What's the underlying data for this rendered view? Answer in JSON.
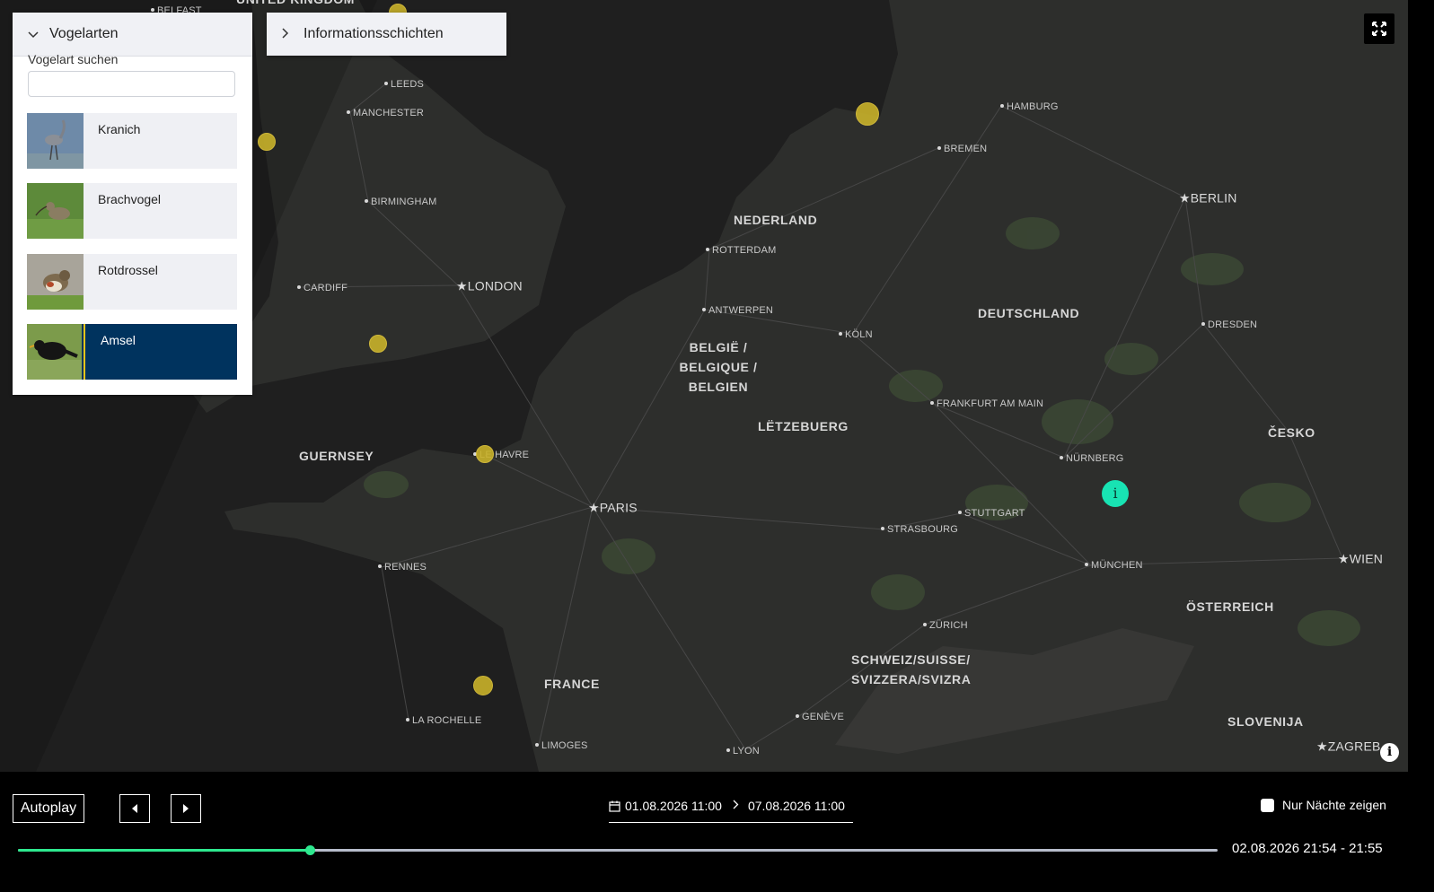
{
  "map": {
    "countries": [
      {
        "id": "united-kingdom",
        "label": "UNITED KINGDOM"
      },
      {
        "id": "nederland",
        "label": "NEDERLAND"
      },
      {
        "id": "deutschland",
        "label": "DEUTSCHLAND"
      },
      {
        "id": "belgie",
        "label": "BELGIË / BELGIQUE / BELGIEN"
      },
      {
        "id": "letzebuerg",
        "label": "LËTZEBUERG"
      },
      {
        "id": "guernsey",
        "label": "GUERNSEY"
      },
      {
        "id": "france",
        "label": "FRANCE"
      },
      {
        "id": "cesko",
        "label": "ČESKO"
      },
      {
        "id": "osterreich",
        "label": "ÖSTERREICH"
      },
      {
        "id": "schweiz",
        "label": "SCHWEIZ/SUISSE/ SVIZZERA/SVIZRA"
      },
      {
        "id": "slovenija",
        "label": "SLOVENIJA"
      }
    ],
    "cities": [
      {
        "id": "belfast",
        "label": "BELFAST"
      },
      {
        "id": "leeds",
        "label": "LEEDS"
      },
      {
        "id": "manchester",
        "label": "MANCHESTER"
      },
      {
        "id": "birmingham",
        "label": "BIRMINGHAM"
      },
      {
        "id": "cardiff",
        "label": "CARDIFF"
      },
      {
        "id": "hamburg",
        "label": "HAMBURG"
      },
      {
        "id": "bremen",
        "label": "BREMEN"
      },
      {
        "id": "rotterdam",
        "label": "ROTTERDAM"
      },
      {
        "id": "antwerpen",
        "label": "ANTWERPEN"
      },
      {
        "id": "koln",
        "label": "KÖLN"
      },
      {
        "id": "dresden",
        "label": "DRESDEN"
      },
      {
        "id": "frankfurt",
        "label": "FRANKFURT AM MAIN"
      },
      {
        "id": "nurnberg",
        "label": "NÜRNBERG"
      },
      {
        "id": "stuttgart",
        "label": "STUTTGART"
      },
      {
        "id": "strasbourg",
        "label": "STRASBOURG"
      },
      {
        "id": "munchen",
        "label": "MÜNCHEN"
      },
      {
        "id": "le-havre",
        "label": "LE HAVRE"
      },
      {
        "id": "rennes",
        "label": "RENNES"
      },
      {
        "id": "zurich",
        "label": "ZÜRICH"
      },
      {
        "id": "geneve",
        "label": "GENÈVE"
      },
      {
        "id": "lyon",
        "label": "LYON"
      },
      {
        "id": "la-rochelle",
        "label": "LA ROCHELLE"
      },
      {
        "id": "limoges",
        "label": "LIMOGES"
      }
    ],
    "capitals": [
      {
        "id": "london",
        "label": "LONDON"
      },
      {
        "id": "berlin",
        "label": "BERLIN"
      },
      {
        "id": "paris",
        "label": "PARIS"
      },
      {
        "id": "wien",
        "label": "WIEN"
      },
      {
        "id": "zagreb",
        "label": "ZAGREB"
      }
    ],
    "info_marker_symbol": "i",
    "colors": {
      "land": "#2b2b2b",
      "water": "#1f1f1f",
      "marker": "#c9b22a",
      "info": "#18e3b3"
    }
  },
  "bird_panel": {
    "title": "Vogelarten",
    "search_label": "Vogelart suchen",
    "search_value": "",
    "search_placeholder": "",
    "birds": [
      {
        "name": "Kranich",
        "selected": false
      },
      {
        "name": "Brachvogel",
        "selected": false
      },
      {
        "name": "Rotdrossel",
        "selected": false
      },
      {
        "name": "Amsel",
        "selected": true
      }
    ]
  },
  "info_panel": {
    "title": "Informationsschichten"
  },
  "controls": {
    "autoplay_label": "Autoplay",
    "start_date": "01.08.2026 11:00",
    "end_date": "07.08.2026 11:00",
    "nights_label": "Nur Nächte zeigen",
    "nights_checked": false,
    "progress": 0.243,
    "current_time": "02.08.2026 21:54 - 21:55",
    "accent": "#2ee88f"
  }
}
